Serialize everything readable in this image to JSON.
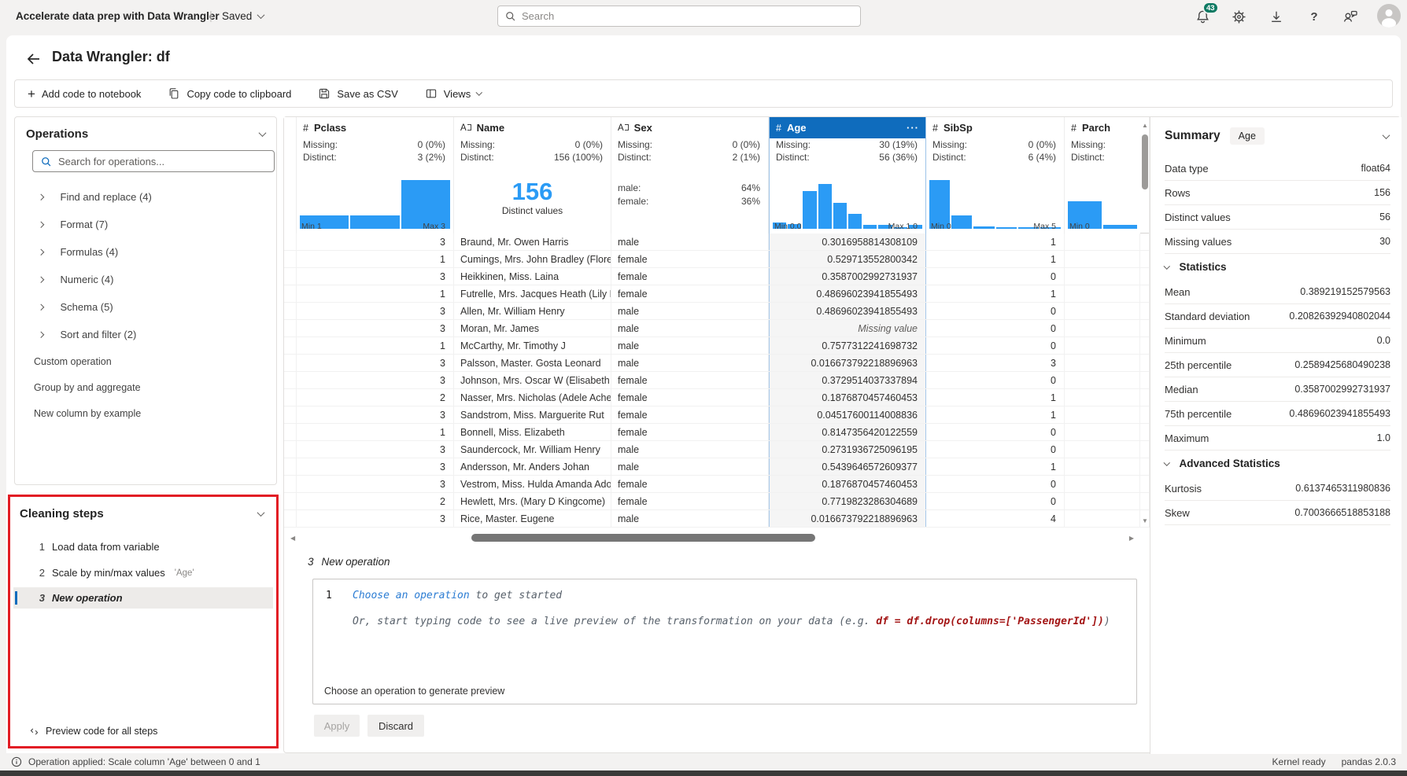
{
  "topbar": {
    "app_title": "Accelerate data prep with Data Wrangler",
    "saved_label": "Saved",
    "search_placeholder": "Search",
    "notification_count": "43"
  },
  "header": {
    "title": "Data Wrangler: df"
  },
  "toolbar": {
    "add_code": "Add code to notebook",
    "copy_code": "Copy code to clipboard",
    "save_csv": "Save as CSV",
    "views": "Views"
  },
  "operations": {
    "title": "Operations",
    "search_placeholder": "Search for operations...",
    "categories": [
      "Find and replace (4)",
      "Format (7)",
      "Formulas (4)",
      "Numeric (4)",
      "Schema (5)",
      "Sort and filter (2)"
    ],
    "links": [
      "Custom operation",
      "Group by and aggregate",
      "New column by example"
    ]
  },
  "cleaning_steps": {
    "title": "Cleaning steps",
    "steps": [
      {
        "num": "1",
        "label": "Load data from variable",
        "detail": ""
      },
      {
        "num": "2",
        "label": "Scale by min/max values",
        "detail": "'Age'"
      },
      {
        "num": "3",
        "label": "New operation",
        "detail": ""
      }
    ],
    "preview_all": "Preview code for all steps"
  },
  "grid": {
    "missing_label": "Missing:",
    "distinct_label": "Distinct:",
    "missing_value_text": "Missing value",
    "columns": [
      {
        "name": "Pclass",
        "type": "number",
        "missing": "0 (0%)",
        "distinct": "3 (2%)",
        "min": "Min 1",
        "max": "Max 3",
        "bars": [
          0.27,
          0.27,
          1.0
        ]
      },
      {
        "name": "Name",
        "type": "text",
        "missing": "0 (0%)",
        "distinct": "156 (100%)",
        "big_value": "156",
        "big_label": "Distinct values"
      },
      {
        "name": "Sex",
        "type": "text",
        "missing": "0 (0%)",
        "distinct": "2 (1%)",
        "categories": [
          {
            "label": "male:",
            "value": "64%"
          },
          {
            "label": "female:",
            "value": "36%"
          }
        ]
      },
      {
        "name": "Age",
        "type": "number",
        "selected": true,
        "menu": "···",
        "missing": "30 (19%)",
        "distinct": "56 (36%)",
        "min": "Min 0.0",
        "max": "Max 1.0",
        "bars": [
          0.13,
          0.1,
          0.78,
          0.92,
          0.54,
          0.3,
          0.08,
          0.08,
          0.03,
          0.08
        ]
      },
      {
        "name": "SibSp",
        "type": "number",
        "missing": "0 (0%)",
        "distinct": "6 (4%)",
        "min": "Min 0",
        "max": "Max 5",
        "bars": [
          1.0,
          0.27,
          0.05,
          0.04,
          0.02,
          0.03
        ]
      },
      {
        "name": "Parch",
        "type": "number",
        "missing": "",
        "distinct": "",
        "min": "Min 0",
        "max": "",
        "bars": [
          0.56,
          0.08
        ]
      }
    ],
    "rows": [
      {
        "pclass": "3",
        "name": "Braund, Mr. Owen Harris",
        "sex": "male",
        "age": "0.3016958814308109",
        "sibsp": "1",
        "parch": ""
      },
      {
        "pclass": "1",
        "name": "Cumings, Mrs. John Bradley (Florenc",
        "sex": "female",
        "age": "0.529713552800342",
        "sibsp": "1",
        "parch": ""
      },
      {
        "pclass": "3",
        "name": "Heikkinen, Miss. Laina",
        "sex": "female",
        "age": "0.3587002992731937",
        "sibsp": "0",
        "parch": ""
      },
      {
        "pclass": "1",
        "name": "Futrelle, Mrs. Jacques Heath (Lily Ma",
        "sex": "female",
        "age": "0.48696023941855493",
        "sibsp": "1",
        "parch": ""
      },
      {
        "pclass": "3",
        "name": "Allen, Mr. William Henry",
        "sex": "male",
        "age": "0.48696023941855493",
        "sibsp": "0",
        "parch": ""
      },
      {
        "pclass": "3",
        "name": "Moran, Mr. James",
        "sex": "male",
        "age": "",
        "age_missing": true,
        "sibsp": "0",
        "parch": ""
      },
      {
        "pclass": "1",
        "name": "McCarthy, Mr. Timothy J",
        "sex": "male",
        "age": "0.7577312241698732",
        "sibsp": "0",
        "parch": ""
      },
      {
        "pclass": "3",
        "name": "Palsson, Master. Gosta Leonard",
        "sex": "male",
        "age": "0.016673792218896963",
        "sibsp": "3",
        "parch": ""
      },
      {
        "pclass": "3",
        "name": "Johnson, Mrs. Oscar W (Elisabeth Vil",
        "sex": "female",
        "age": "0.3729514037337894",
        "sibsp": "0",
        "parch": ""
      },
      {
        "pclass": "2",
        "name": "Nasser, Mrs. Nicholas (Adele Achem",
        "sex": "female",
        "age": "0.1876870457460453",
        "sibsp": "1",
        "parch": ""
      },
      {
        "pclass": "3",
        "name": "Sandstrom, Miss. Marguerite Rut",
        "sex": "female",
        "age": "0.04517600114008836",
        "sibsp": "1",
        "parch": ""
      },
      {
        "pclass": "1",
        "name": "Bonnell, Miss. Elizabeth",
        "sex": "female",
        "age": "0.8147356420122559",
        "sibsp": "0",
        "parch": ""
      },
      {
        "pclass": "3",
        "name": "Saundercock, Mr. William Henry",
        "sex": "male",
        "age": "0.2731936725096195",
        "sibsp": "0",
        "parch": ""
      },
      {
        "pclass": "3",
        "name": "Andersson, Mr. Anders Johan",
        "sex": "male",
        "age": "0.5439646572609377",
        "sibsp": "1",
        "parch": ""
      },
      {
        "pclass": "3",
        "name": "Vestrom, Miss. Hulda Amanda Adolf",
        "sex": "female",
        "age": "0.1876870457460453",
        "sibsp": "0",
        "parch": ""
      },
      {
        "pclass": "2",
        "name": "Hewlett, Mrs. (Mary D Kingcome)",
        "sex": "female",
        "age": "0.7719823286304689",
        "sibsp": "0",
        "parch": ""
      },
      {
        "pclass": "3",
        "name": "Rice, Master. Eugene",
        "sex": "male",
        "age": "0.016673792218896963",
        "sibsp": "4",
        "parch": ""
      }
    ]
  },
  "code_panel": {
    "step_num": "3",
    "step_name": "New operation",
    "line_number": "1",
    "link_text": "Choose an operation",
    "line1_rest": " to get started",
    "line2_prefix": "Or, start typing code to see a live preview of the transformation on your data (e.g. ",
    "line2_code": "df = df.drop(columns=['PassengerId'])",
    "line2_suffix": ")",
    "status": "Choose an operation to generate preview",
    "apply_label": "Apply",
    "discard_label": "Discard"
  },
  "summary": {
    "title": "Summary",
    "badge": "Age",
    "rows": [
      [
        "Data type",
        "float64"
      ],
      [
        "Rows",
        "156"
      ],
      [
        "Distinct values",
        "56"
      ],
      [
        "Missing values",
        "30"
      ]
    ],
    "stats_title": "Statistics",
    "stats": [
      [
        "Mean",
        "0.389219152579563"
      ],
      [
        "Standard deviation",
        "0.20826392940802044"
      ],
      [
        "Minimum",
        "0.0"
      ],
      [
        "25th percentile",
        "0.2589425680490238"
      ],
      [
        "Median",
        "0.3587002992731937"
      ],
      [
        "75th percentile",
        "0.48696023941855493"
      ],
      [
        "Maximum",
        "1.0"
      ]
    ],
    "adv_title": "Advanced Statistics",
    "adv": [
      [
        "Kurtosis",
        "0.6137465311980836"
      ],
      [
        "Skew",
        "0.7003666518853188"
      ]
    ]
  },
  "statusbar": {
    "message": "Operation applied: Scale column 'Age' between 0 and 1",
    "kernel": "Kernel ready",
    "pandas": "pandas 2.0.3"
  },
  "colors": {
    "accent_blue": "#0f6cbd",
    "histogram_blue": "#2b9bf5",
    "notification_teal": "#0e7a63",
    "highlight_red": "#e21c24"
  }
}
